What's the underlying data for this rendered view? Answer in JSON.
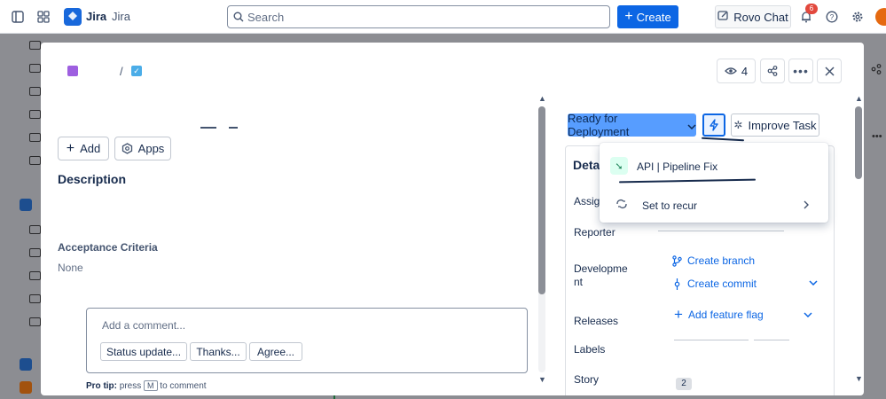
{
  "topbar": {
    "app_name": "Jira",
    "app_subtitle": "Jira",
    "search_placeholder": "Search",
    "create_label": "Create",
    "rovo_label": "Rovo Chat",
    "notifications_count": "6"
  },
  "modal": {
    "breadcrumb_separator": "/",
    "watchers_count": "4",
    "add_label": "Add",
    "apps_label": "Apps",
    "description_heading": "Description",
    "acceptance_heading": "Acceptance Criteria",
    "acceptance_value": "None",
    "comment_placeholder": "Add a comment...",
    "comment_chips": [
      "Status update...",
      "Thanks...",
      "Agree..."
    ],
    "protip_label": "Pro tip:",
    "protip_press": "press",
    "protip_key": "M",
    "protip_rest": "to comment"
  },
  "side": {
    "status_label": "Ready for Deployment",
    "improve_label": "Improve Task",
    "details_heading": "Detai",
    "fields": {
      "assignee": "Assig",
      "reporter": "Reporter",
      "development_line1": "Developme",
      "development_line2": "nt",
      "releases": "Releases",
      "labels": "Labels",
      "story_points_label": "Story",
      "story_points_value": "2"
    },
    "links": {
      "create_branch": "Create branch",
      "create_commit": "Create commit",
      "add_feature_flag": "Add feature flag"
    }
  },
  "dropdown": {
    "items": [
      "API | Pipeline Fix",
      "Set to recur"
    ]
  },
  "colors": {
    "accent": "#0c66e4",
    "status": "#579dff"
  }
}
